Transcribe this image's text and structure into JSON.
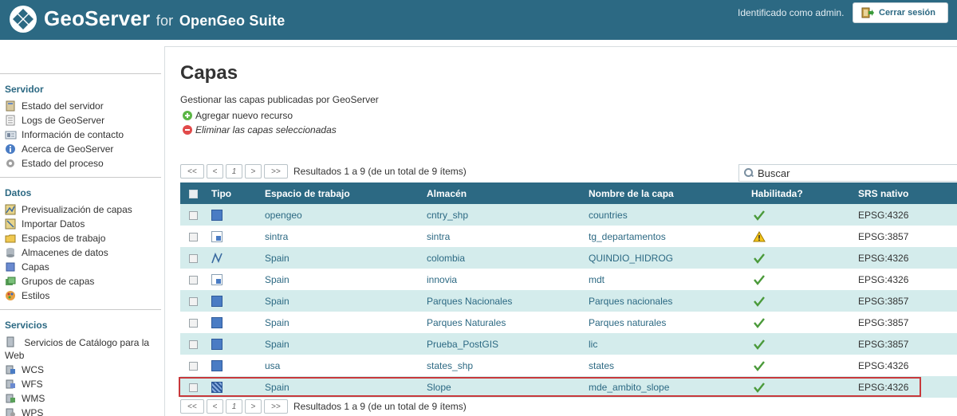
{
  "header": {
    "brand": "GeoServer",
    "brand_for": "for",
    "brand_suite": "OpenGeo Suite",
    "login_text": "Identificado como admin.",
    "logout_label": "Cerrar sesión"
  },
  "sidebar": {
    "sections": [
      {
        "title": "Servidor",
        "items": [
          {
            "label": "Estado del servidor",
            "icon": "server-status-icon"
          },
          {
            "label": "Logs de GeoServer",
            "icon": "logs-icon"
          },
          {
            "label": "Información de contacto",
            "icon": "contact-icon"
          },
          {
            "label": "Acerca de GeoServer",
            "icon": "about-icon"
          },
          {
            "label": "Estado del proceso",
            "icon": "process-status-icon"
          }
        ]
      },
      {
        "title": "Datos",
        "items": [
          {
            "label": "Previsualización de capas",
            "icon": "layer-preview-icon"
          },
          {
            "label": "Importar Datos",
            "icon": "import-data-icon"
          },
          {
            "label": "Espacios de trabajo",
            "icon": "workspaces-icon"
          },
          {
            "label": "Almacenes de datos",
            "icon": "stores-icon"
          },
          {
            "label": "Capas",
            "icon": "layers-icon"
          },
          {
            "label": "Grupos de capas",
            "icon": "layer-groups-icon"
          },
          {
            "label": "Estilos",
            "icon": "styles-icon"
          }
        ]
      },
      {
        "title": "Servicios",
        "items": [
          {
            "label": "Servicios de Catálogo para la Web",
            "icon": "csw-icon"
          },
          {
            "label": "WCS",
            "icon": "wcs-icon"
          },
          {
            "label": "WFS",
            "icon": "wfs-icon"
          },
          {
            "label": "WMS",
            "icon": "wms-icon"
          },
          {
            "label": "WPS",
            "icon": "wps-icon"
          }
        ]
      }
    ]
  },
  "main": {
    "title": "Capas",
    "description": "Gestionar las capas publicadas por GeoServer",
    "add_label": "Agregar nuevo recurso",
    "delete_label": "Eliminar las capas seleccionadas",
    "pager": {
      "first": "<<",
      "prev": "<",
      "current": "1",
      "next": ">",
      "last": ">>",
      "results": "Resultados 1 a 9 (de un total de 9 ítems)"
    },
    "search_placeholder": "Buscar",
    "columns": [
      "Tipo",
      "Espacio de trabajo",
      "Almacén",
      "Nombre de la capa",
      "Habilitada?",
      "SRS nativo"
    ],
    "rows": [
      {
        "type": "polygon",
        "workspace": "opengeo",
        "store": "cntry_shp",
        "name": "countries",
        "enabled": "check",
        "srs": "EPSG:4326"
      },
      {
        "type": "raster",
        "workspace": "sintra",
        "store": "sintra",
        "name": "tg_departamentos",
        "enabled": "warning",
        "srs": "EPSG:3857"
      },
      {
        "type": "line",
        "workspace": "Spain",
        "store": "colombia",
        "name": "QUINDIO_HIDROG",
        "enabled": "check",
        "srs": "EPSG:4326"
      },
      {
        "type": "raster",
        "workspace": "Spain",
        "store": "innovia",
        "name": "mdt",
        "enabled": "check",
        "srs": "EPSG:4326"
      },
      {
        "type": "polygon",
        "workspace": "Spain",
        "store": "Parques Nacionales",
        "name": "Parques nacionales",
        "enabled": "check",
        "srs": "EPSG:3857"
      },
      {
        "type": "polygon",
        "workspace": "Spain",
        "store": "Parques Naturales",
        "name": "Parques naturales",
        "enabled": "check",
        "srs": "EPSG:3857"
      },
      {
        "type": "polygon",
        "workspace": "Spain",
        "store": "Prueba_PostGIS",
        "name": "lic",
        "enabled": "check",
        "srs": "EPSG:3857"
      },
      {
        "type": "polygon",
        "workspace": "usa",
        "store": "states_shp",
        "name": "states",
        "enabled": "check",
        "srs": "EPSG:4326"
      },
      {
        "type": "mosaic",
        "workspace": "Spain",
        "store": "Slope",
        "name": "mde_ambito_slope",
        "enabled": "check",
        "srs": "EPSG:4326"
      }
    ]
  },
  "colors": {
    "header_bg": "#2c6983",
    "row_alt": "#d4ecec",
    "link": "#2c6983",
    "highlight": "#c8383b"
  }
}
